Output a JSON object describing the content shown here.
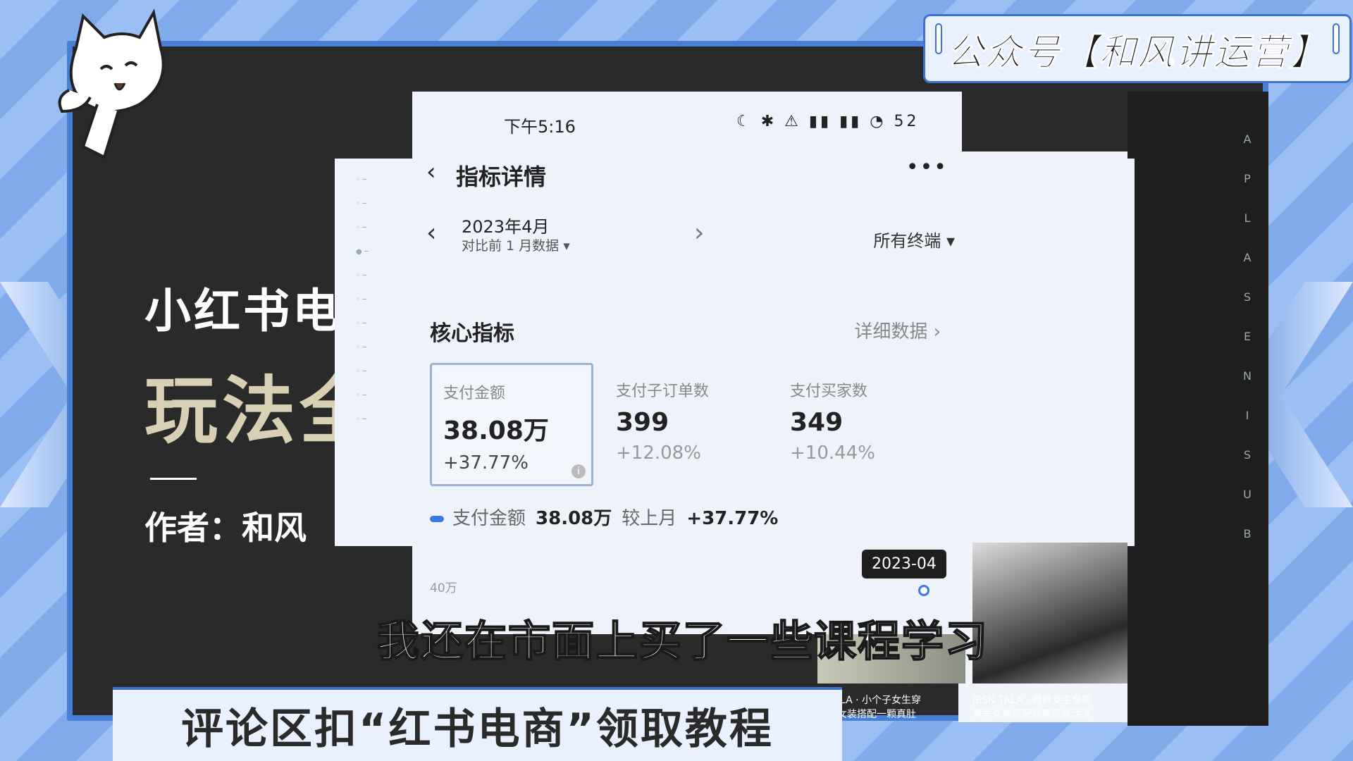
{
  "wechat_banner": {
    "text": "公众号【和风讲运营】"
  },
  "cover": {
    "title_line1": "小红书电",
    "title_line2": "玩法全",
    "author": "作者：和风"
  },
  "phone": {
    "status_time": "下午5:16",
    "status_icons": "☾ ✱ ⚠ ▮▮ ▮▮ ◔ 52",
    "back_icon": "‹",
    "page_title": "指标详情",
    "more_icon": "•••",
    "date_prev_icon": "‹",
    "date_month": "2023年4月",
    "date_compare": "对比前 1 月数据 ▾",
    "date_next_icon": "›",
    "terminal_select": "所有终端 ▾",
    "core_heading": "核心指标",
    "detail_link": "详细数据 ›",
    "metrics": [
      {
        "label": "支付金额",
        "value": "38.08万",
        "delta": "+37.77%"
      },
      {
        "label": "支付子订单数",
        "value": "399",
        "delta": "+12.08%"
      },
      {
        "label": "支付买家数",
        "value": "349",
        "delta": "+10.44%"
      }
    ],
    "legend": {
      "series": "支付金额",
      "value": "38.08万",
      "compare_label": "较上月",
      "compare_value": "+37.77%"
    },
    "y_label": "40万",
    "tooltip": "2023-04"
  },
  "background_panel": {
    "product_caption1": "N TALA · 小个子女生穿\n夏季女装搭配一颗真肚",
    "product_caption2": "JESN TALA · 微胖女生穿搭\n夏季女装搭配显瘦显高活泼"
  },
  "subtitle": "我还在市面上买了一些课程学习",
  "bottom_banner": "评论区扣“红书电商”领取教程",
  "vertical_text": [
    "A",
    "P",
    "L",
    "A",
    "S",
    "E",
    "N",
    "I",
    "S",
    "U",
    "B"
  ]
}
